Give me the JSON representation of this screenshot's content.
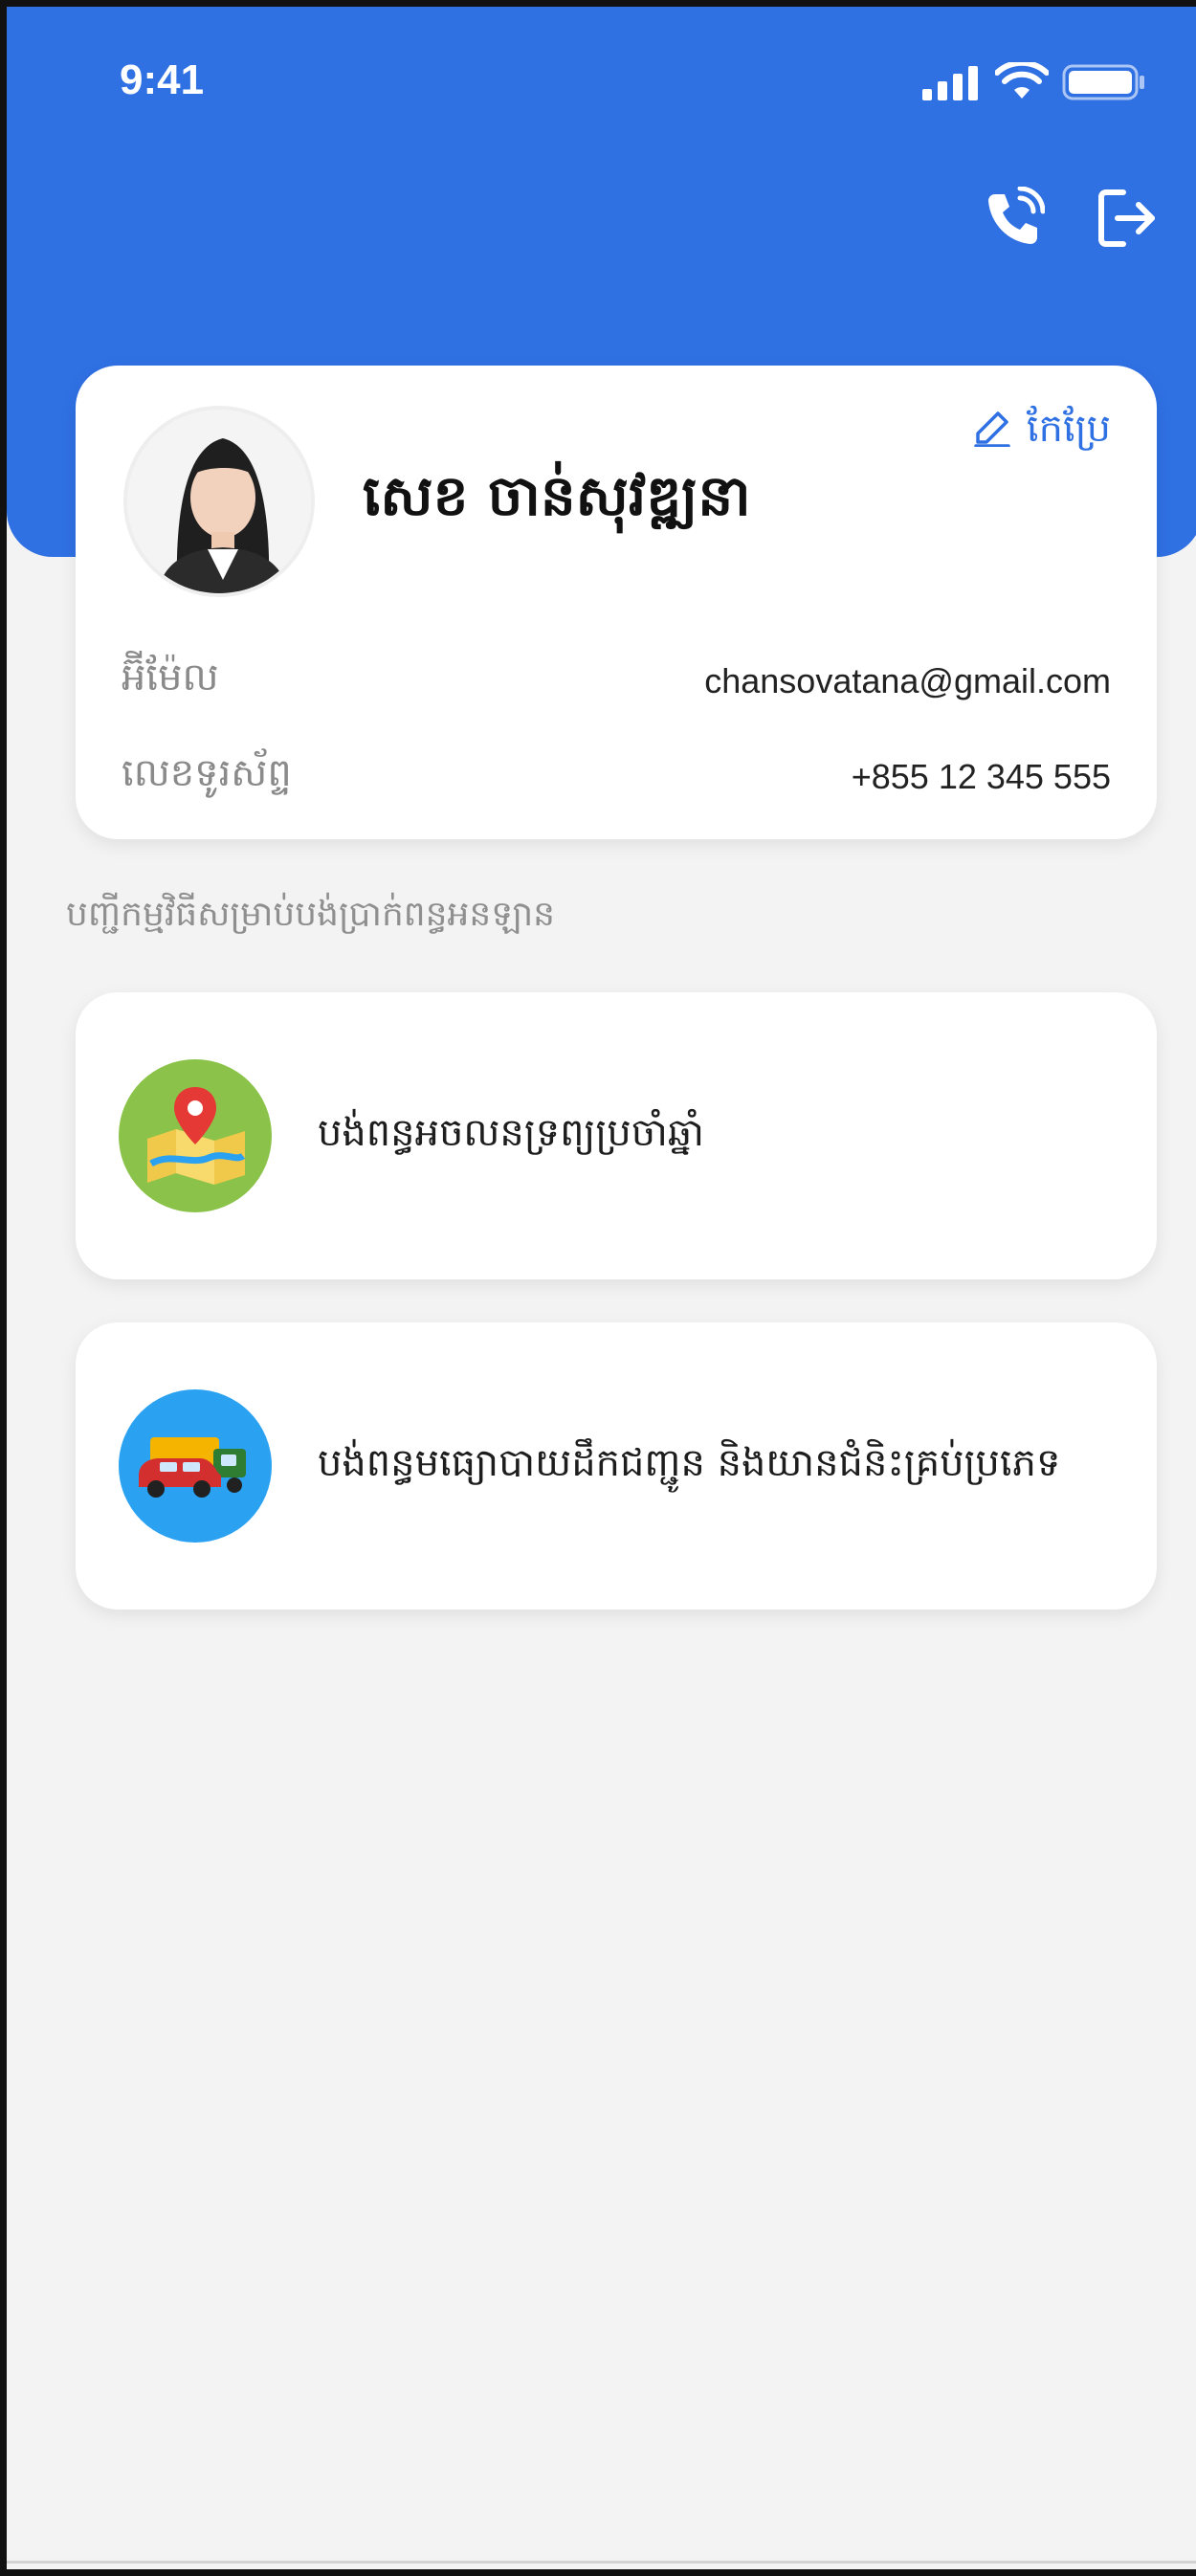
{
  "status_bar": {
    "time": "9:41",
    "icons": [
      "cellular-signal-icon",
      "wifi-icon",
      "battery-icon"
    ]
  },
  "header": {
    "actions": [
      "phone-call-icon",
      "logout-icon"
    ],
    "colors": {
      "primary": "#2f70e3",
      "background": "#f3f3f3"
    }
  },
  "profile": {
    "name": "សេខ ចាន់សុវឌ្ឍនា",
    "edit_label": "កែប្រែ",
    "email_label": "អ៊ីម៉ែល",
    "email_value": "chansovatana@gmail.com",
    "phone_label": "លេខទូរស័ព្ទ",
    "phone_value": "+855 12 345 555"
  },
  "section": {
    "title": "បញ្ជីកម្មវិធីសម្រាប់បង់ប្រាក់ពន្ធអនឡាន"
  },
  "services": [
    {
      "label": "បង់ពន្ធអចលនទ្រព្យប្រចាំឆ្នាំ",
      "icon": "map-location-icon",
      "color": "#8bc34a"
    },
    {
      "label": "បង់ពន្ធមធ្យោបាយដឹកជញ្ជូន និងយានជំនិះគ្រប់ប្រភេទ",
      "icon": "vehicles-icon",
      "color": "#2ba1f2"
    }
  ]
}
